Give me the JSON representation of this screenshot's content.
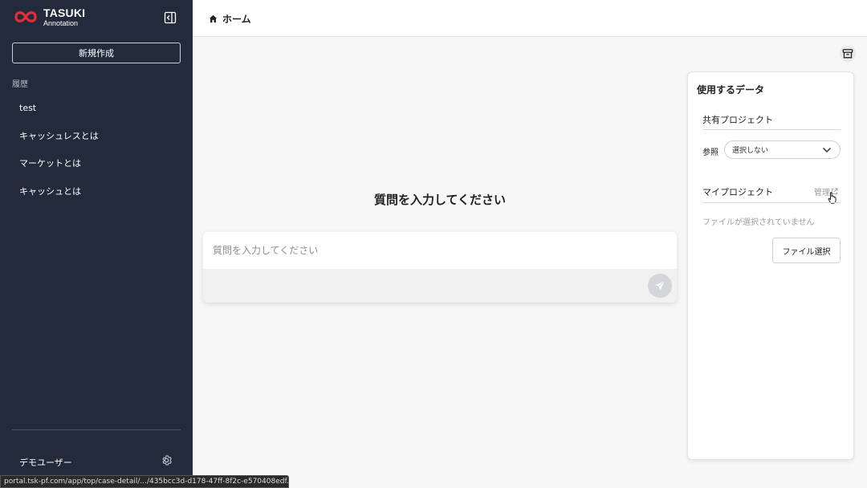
{
  "brand": {
    "name": "TASUKI",
    "sub": "Annotation"
  },
  "sidebar": {
    "new_button": "新規作成",
    "history_label": "履歴",
    "history": [
      "test",
      "キャッシュレスとは",
      "マーケットとは",
      "キャッシュとは"
    ],
    "user_name": "デモユーザー"
  },
  "header": {
    "breadcrumb": "ホーム"
  },
  "main": {
    "title": "質問を入力してください",
    "input_placeholder": "質問を入力してください"
  },
  "data_panel": {
    "title": "使用するデータ",
    "shared_project": "共有プロジェクト",
    "reference_label": "参照",
    "reference_value": "選択しない",
    "my_project": "マイプロジェクト",
    "manage_link": "管理",
    "no_file": "ファイルが選択されていません",
    "file_button": "ファイル選択"
  },
  "status_url": "portal.tsk-pf.com/app/top/case-detail/.../435bcc3d-d178-47ff-8f2c-e570408edf...",
  "colors": {
    "sidebar_bg": "#232a3b",
    "brand_red": "#e0303a",
    "page_bg": "#f7f7f8"
  }
}
